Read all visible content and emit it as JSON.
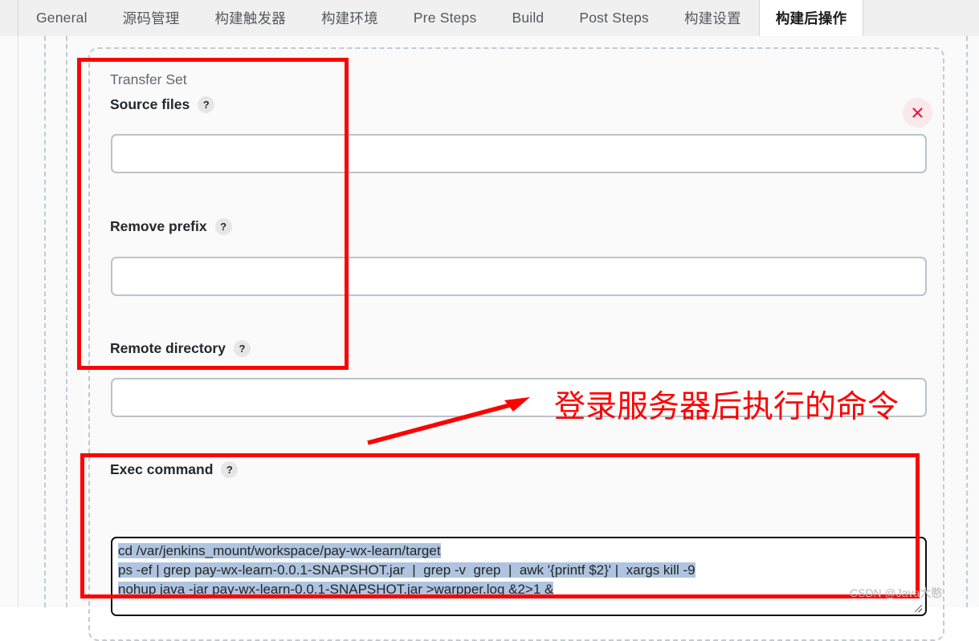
{
  "tabs": [
    {
      "label": "General",
      "active": false
    },
    {
      "label": "源码管理",
      "active": false
    },
    {
      "label": "构建触发器",
      "active": false
    },
    {
      "label": "构建环境",
      "active": false
    },
    {
      "label": "Pre Steps",
      "active": false
    },
    {
      "label": "Build",
      "active": false
    },
    {
      "label": "Post Steps",
      "active": false
    },
    {
      "label": "构建设置",
      "active": false
    },
    {
      "label": "构建后操作",
      "active": true
    }
  ],
  "panel": {
    "section_title": "Transfer Set",
    "close_label": "×",
    "help_badge": "?",
    "fields": [
      {
        "name": "source-files",
        "label": "Source files",
        "value": "",
        "placeholder": ""
      },
      {
        "name": "remove-prefix",
        "label": "Remove prefix",
        "value": "",
        "placeholder": ""
      },
      {
        "name": "remote-directory",
        "label": "Remote directory",
        "value": "",
        "placeholder": ""
      }
    ],
    "exec": {
      "label": "Exec command",
      "lines": [
        "cd /var/jenkins_mount/workspace/pay-wx-learn/target",
        "ps -ef | grep pay-wx-learn-0.0.1-SNAPSHOT.jar  |  grep -v  grep  |  awk '{printf $2}' |  xargs kill -9",
        "nohup java -jar pay-wx-learn-0.0.1-SNAPSHOT.jar >warpper.log &2>1 &"
      ],
      "selection_color": "#aec4e0"
    }
  },
  "annotations": {
    "note_text": "登录服务器后执行的命令",
    "color": "#fe0000",
    "box_count": 2
  },
  "watermark": "CSDN @Java大憨",
  "colors": {
    "tab_bar_bg": "#f0f0f0",
    "page_bg": "#fafafa",
    "input_border": "#b9c3cb",
    "dashed_border": "#c3cbd1",
    "annotation_red": "#fe0000",
    "close_bg": "#fae9ec"
  }
}
